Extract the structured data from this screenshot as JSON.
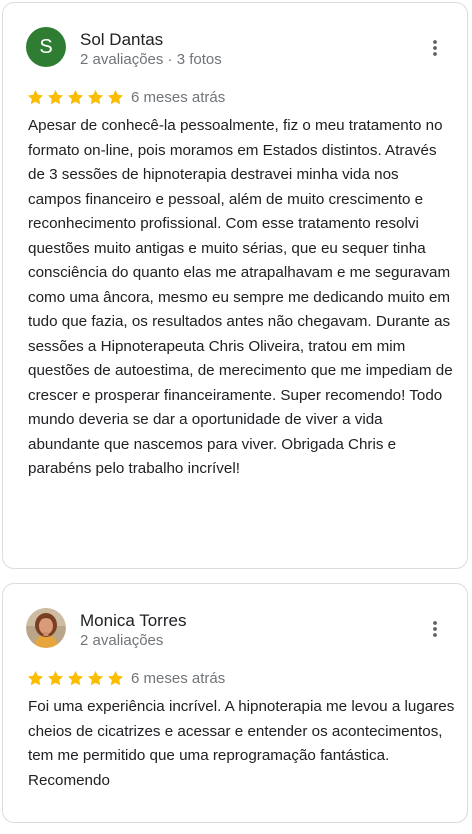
{
  "colors": {
    "star": "#fbbc04",
    "avatar_bg": "#2e7d32",
    "meta_text": "#70757a",
    "card_border": "#dadce0"
  },
  "reviews": [
    {
      "avatar_letter": "S",
      "name": "Sol Dantas",
      "meta": "2 avaliações · 3 fotos",
      "rating": 5,
      "date": "6 meses atrás",
      "more_icon": "more-vert-icon",
      "text": "Apesar de conhecê-la pessoalmente, fiz o meu tratamento no formato on-line, pois moramos em Estados distintos. Através de 3 sessões de hipnoterapia destravei minha vida nos campos financeiro e pessoal, além de muito crescimento e reconhecimento profissional. Com esse tratamento resolvi questões muito antigas e muito sérias, que eu sequer tinha consciência do quanto elas me atrapalhavam e me seguravam como uma âncora, mesmo eu sempre me dedicando muito em tudo que fazia, os resultados antes não chegavam. Durante as sessões a Hipnoterapeuta Chris Oliveira, tratou em mim questões de autoestima, de merecimento que me impediam de crescer e prosperar financeiramente. Super recomendo! Todo mundo deveria se dar a oportunidade de viver a vida abundante que nascemos para viver. Obrigada Chris e parabéns pelo trabalho incrível!"
    },
    {
      "avatar_icon": "profile-photo",
      "name": "Monica Torres",
      "meta": "2 avaliações",
      "rating": 5,
      "date": "6 meses atrás",
      "more_icon": "more-vert-icon",
      "text": "Foi uma experiência incrível. A hipnoterapia me levou a lugares cheios de cicatrizes e acessar e entender os acontecimentos, tem me permitido que uma reprogramação fantástica. Recomendo"
    }
  ]
}
